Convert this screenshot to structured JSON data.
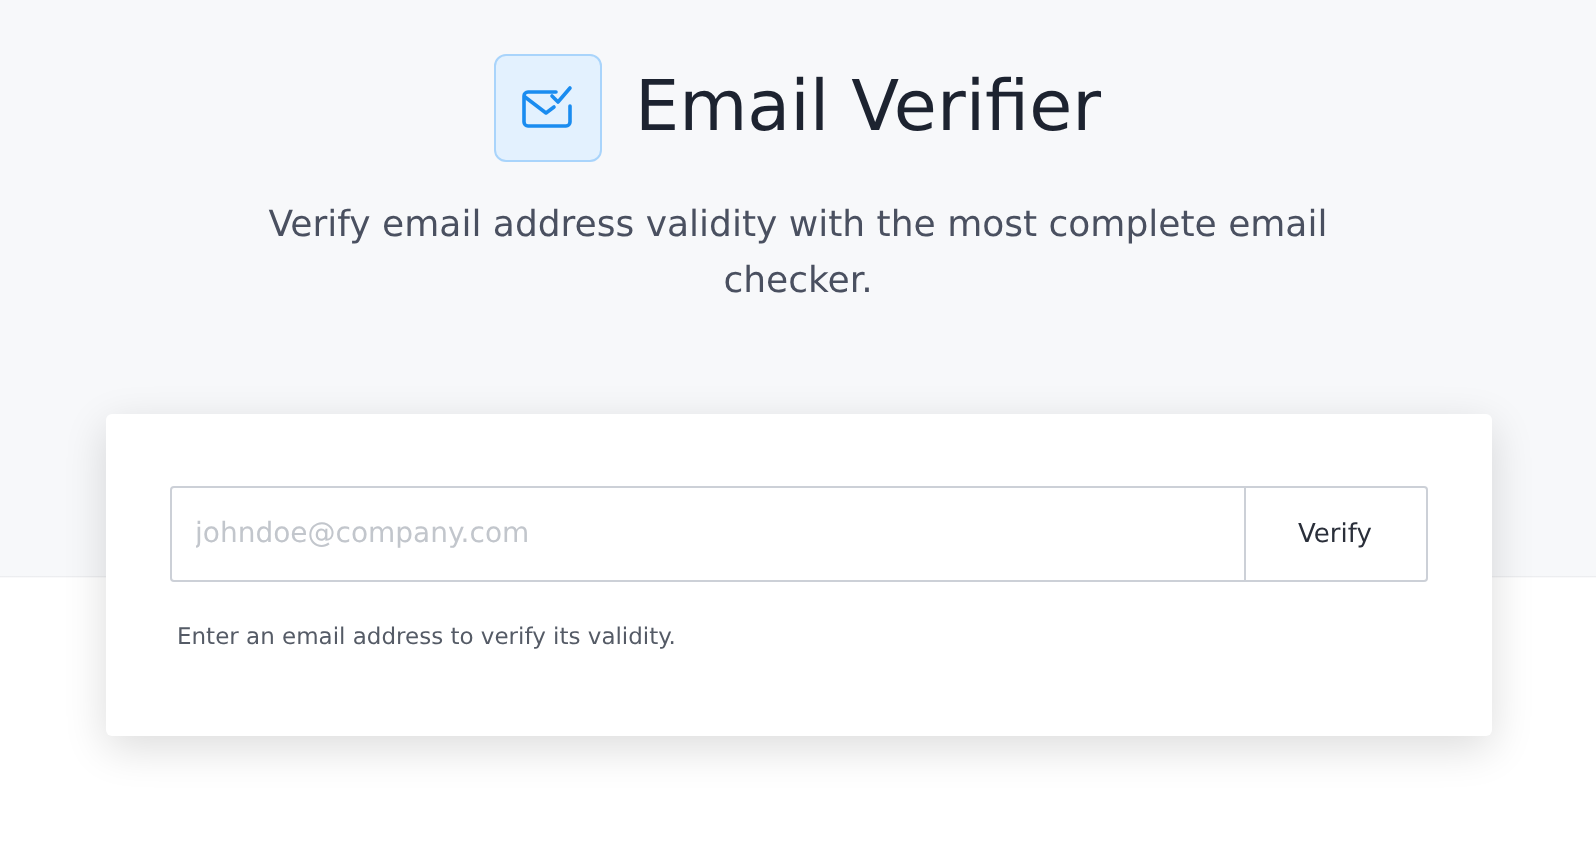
{
  "header": {
    "title": "Email Verifier",
    "subtitle": "Verify email address validity with the most complete email checker."
  },
  "form": {
    "placeholder": "johndoe@company.com",
    "button": "Verify",
    "hint": "Enter an email address to verify its validity."
  }
}
